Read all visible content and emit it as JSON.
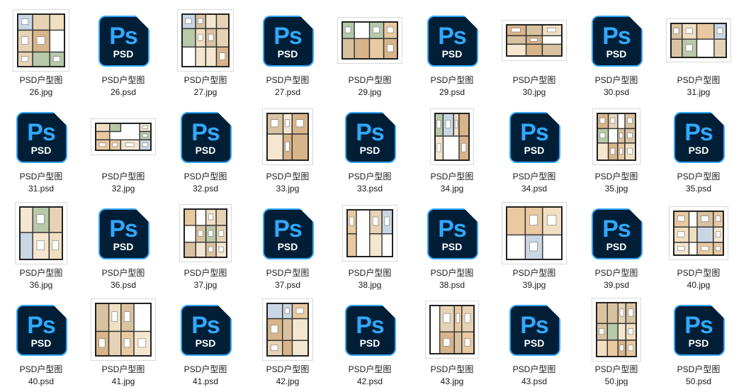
{
  "icons": {
    "psd": "photoshop-psd-file-icon",
    "jpg": "floor-plan-image-thumbnail"
  },
  "psd_icon": {
    "letters": "Ps",
    "badge": "PSD",
    "bg": "#001e36",
    "accent": "#31a8ff"
  },
  "files": [
    {
      "line1": "PSD户型图",
      "line2": "26.jpg",
      "kind": "jpg"
    },
    {
      "line1": "PSD户型图",
      "line2": "26.psd",
      "kind": "psd"
    },
    {
      "line1": "PSD户型图",
      "line2": "27.jpg",
      "kind": "jpg"
    },
    {
      "line1": "PSD户型图",
      "line2": "27.psd",
      "kind": "psd"
    },
    {
      "line1": "PSD户型图",
      "line2": "29.jpg",
      "kind": "jpg"
    },
    {
      "line1": "PSD户型图",
      "line2": "29.psd",
      "kind": "psd"
    },
    {
      "line1": "PSD户型图",
      "line2": "30.jpg",
      "kind": "jpg"
    },
    {
      "line1": "PSD户型图",
      "line2": "30.psd",
      "kind": "psd"
    },
    {
      "line1": "PSD户型图",
      "line2": "31.jpg",
      "kind": "jpg"
    },
    {
      "line1": "PSD户型图",
      "line2": "31.psd",
      "kind": "psd"
    },
    {
      "line1": "PSD户型图",
      "line2": "32.jpg",
      "kind": "jpg"
    },
    {
      "line1": "PSD户型图",
      "line2": "32.psd",
      "kind": "psd"
    },
    {
      "line1": "PSD户型图",
      "line2": "33.jpg",
      "kind": "jpg"
    },
    {
      "line1": "PSD户型图",
      "line2": "33.psd",
      "kind": "psd"
    },
    {
      "line1": "PSD户型图",
      "line2": "34.jpg",
      "kind": "jpg"
    },
    {
      "line1": "PSD户型图",
      "line2": "34.psd",
      "kind": "psd"
    },
    {
      "line1": "PSD户型图",
      "line2": "35.jpg",
      "kind": "jpg"
    },
    {
      "line1": "PSD户型图",
      "line2": "35.psd",
      "kind": "psd"
    },
    {
      "line1": "PSD户型图",
      "line2": "36.jpg",
      "kind": "jpg"
    },
    {
      "line1": "PSD户型图",
      "line2": "36.psd",
      "kind": "psd"
    },
    {
      "line1": "PSD户型图",
      "line2": "37.jpg",
      "kind": "jpg"
    },
    {
      "line1": "PSD户型图",
      "line2": "37.psd",
      "kind": "psd"
    },
    {
      "line1": "PSD户型图",
      "line2": "38.jpg",
      "kind": "jpg"
    },
    {
      "line1": "PSD户型图",
      "line2": "38.psd",
      "kind": "psd"
    },
    {
      "line1": "PSD户型图",
      "line2": "39.jpg",
      "kind": "jpg"
    },
    {
      "line1": "PSD户型图",
      "line2": "39.psd",
      "kind": "psd"
    },
    {
      "line1": "PSD户型图",
      "line2": "40.jpg",
      "kind": "jpg"
    },
    {
      "line1": "PSD户型图",
      "line2": "40.psd",
      "kind": "psd"
    },
    {
      "line1": "PSD户型图",
      "line2": "41.jpg",
      "kind": "jpg"
    },
    {
      "line1": "PSD户型图",
      "line2": "41.psd",
      "kind": "psd"
    },
    {
      "line1": "PSD户型图",
      "line2": "42.jpg",
      "kind": "jpg"
    },
    {
      "line1": "PSD户型图",
      "line2": "42.psd",
      "kind": "psd"
    },
    {
      "line1": "PSD户型图",
      "line2": "43.jpg",
      "kind": "jpg"
    },
    {
      "line1": "PSD户型图",
      "line2": "43.psd",
      "kind": "psd"
    },
    {
      "line1": "PSD户型图",
      "line2": "50.jpg",
      "kind": "jpg"
    },
    {
      "line1": "PSD户型图",
      "line2": "50.psd",
      "kind": "psd"
    }
  ]
}
